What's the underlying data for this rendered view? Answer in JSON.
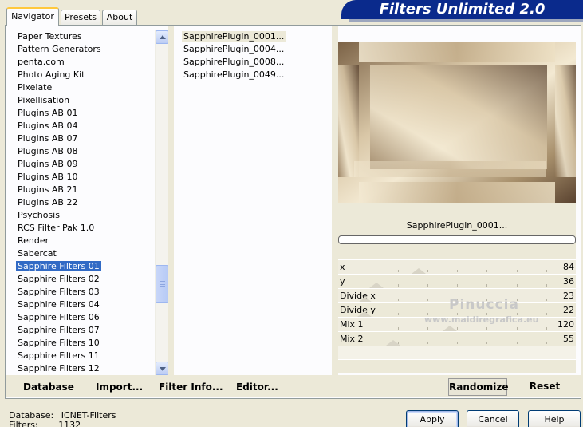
{
  "tabs": [
    "Navigator",
    "Presets",
    "About"
  ],
  "banner": "Filters Unlimited 2.0",
  "categories": [
    "Paper Textures",
    "Pattern Generators",
    "penta.com",
    "Photo Aging Kit",
    "Pixelate",
    "Pixellisation",
    "Plugins AB 01",
    "Plugins AB 04",
    "Plugins AB 07",
    "Plugins AB 08",
    "Plugins AB 09",
    "Plugins AB 10",
    "Plugins AB 21",
    "Plugins AB 22",
    "Psychosis",
    "RCS Filter Pak 1.0",
    "Render",
    "Sabercat",
    "Sapphire Filters 01",
    "Sapphire Filters 02",
    "Sapphire Filters 03",
    "Sapphire Filters 04",
    "Sapphire Filters 06",
    "Sapphire Filters 07",
    "Sapphire Filters 10",
    "Sapphire Filters 11",
    "Sapphire Filters 12"
  ],
  "selected_category": "Sapphire Filters 01",
  "filters": [
    "SapphirePlugin_0001...",
    "SapphirePlugin_0004...",
    "SapphirePlugin_0008...",
    "SapphirePlugin_0049..."
  ],
  "selected_filter": "SapphirePlugin_0001...",
  "preview_colors": [
    "#F3E9D2",
    "#D9C7A7",
    "#A8906C",
    "#7B6246",
    "#5A4330"
  ],
  "params": [
    {
      "label": "x",
      "value": "84",
      "level": 84
    },
    {
      "label": "y",
      "value": "36",
      "level": 36
    },
    {
      "label": "Divide x",
      "value": "23",
      "level": 23
    },
    {
      "label": "Divide y",
      "value": "22",
      "level": 22
    },
    {
      "label": "Mix 1",
      "value": "120",
      "level": 120
    },
    {
      "label": "Mix 2",
      "value": "55",
      "level": 55
    }
  ],
  "watermark": {
    "line1": "Pinuccia",
    "line2": "www.maidiregrafica.eu"
  },
  "bottom_buttons": {
    "database": "Database",
    "import": "Import...",
    "filter_info": "Filter Info...",
    "editor": "Editor...",
    "randomize": "Randomize",
    "reset": "Reset"
  },
  "status": {
    "database_label": "Database:",
    "database_value": "ICNET-Filters",
    "filters_label": "Filters:",
    "filters_value": "1132"
  },
  "dialog_buttons": {
    "apply": "Apply",
    "cancel": "Cancel",
    "help": "Help"
  }
}
